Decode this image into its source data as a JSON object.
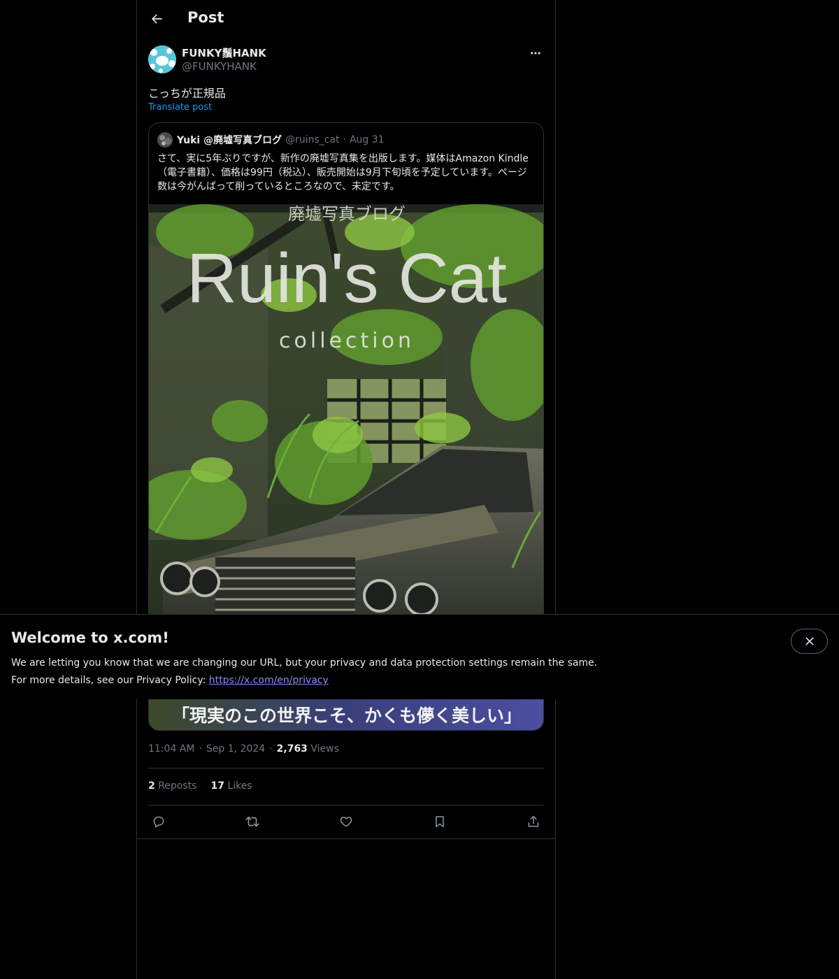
{
  "header": {
    "title": "Post"
  },
  "post": {
    "author_name": "FUNKY鬚HANK",
    "author_handle": "@FUNKYHANK",
    "text": "こっちが正規品",
    "translate_label": "Translate post",
    "time": "11:04 AM",
    "date": "Sep 1, 2024",
    "views_count": "2,763",
    "views_label": "Views",
    "reposts_count": "2",
    "reposts_label": "Reposts",
    "likes_count": "17",
    "likes_label": "Likes"
  },
  "quote": {
    "name": "Yuki @廃墟写真ブログ",
    "handle": "@ruins_cat",
    "date": "Aug 31",
    "text": "さて、実に5年ぶりですが、新作の廃墟写真集を出版します。媒体はAmazon Kindle（電子書籍）、価格は99円（税込）、販売開始は9月下旬頃を予定しています。ページ数は今がんばって削っているところなので、未定です。",
    "cover": {
      "subtitle_top": "廃墟写真ブログ",
      "title": "Ruin's Cat",
      "subtitle": "collection",
      "tagline": "「現実のこの世界こそ、かくも儚く美しい」"
    }
  },
  "banner": {
    "title": "Welcome to x.com!",
    "line1": "We are letting you know that we are changing our URL, but your privacy and data protection settings remain the same.",
    "line2_prefix": "For more details, see our Privacy Policy:",
    "link": "https://x.com/en/privacy"
  },
  "colors": {
    "background": "#000000",
    "text": "#e7e9ea",
    "muted": "#71767b",
    "accent": "#1d9bf0",
    "border": "#2f3336",
    "link": "#8a8cf3"
  }
}
